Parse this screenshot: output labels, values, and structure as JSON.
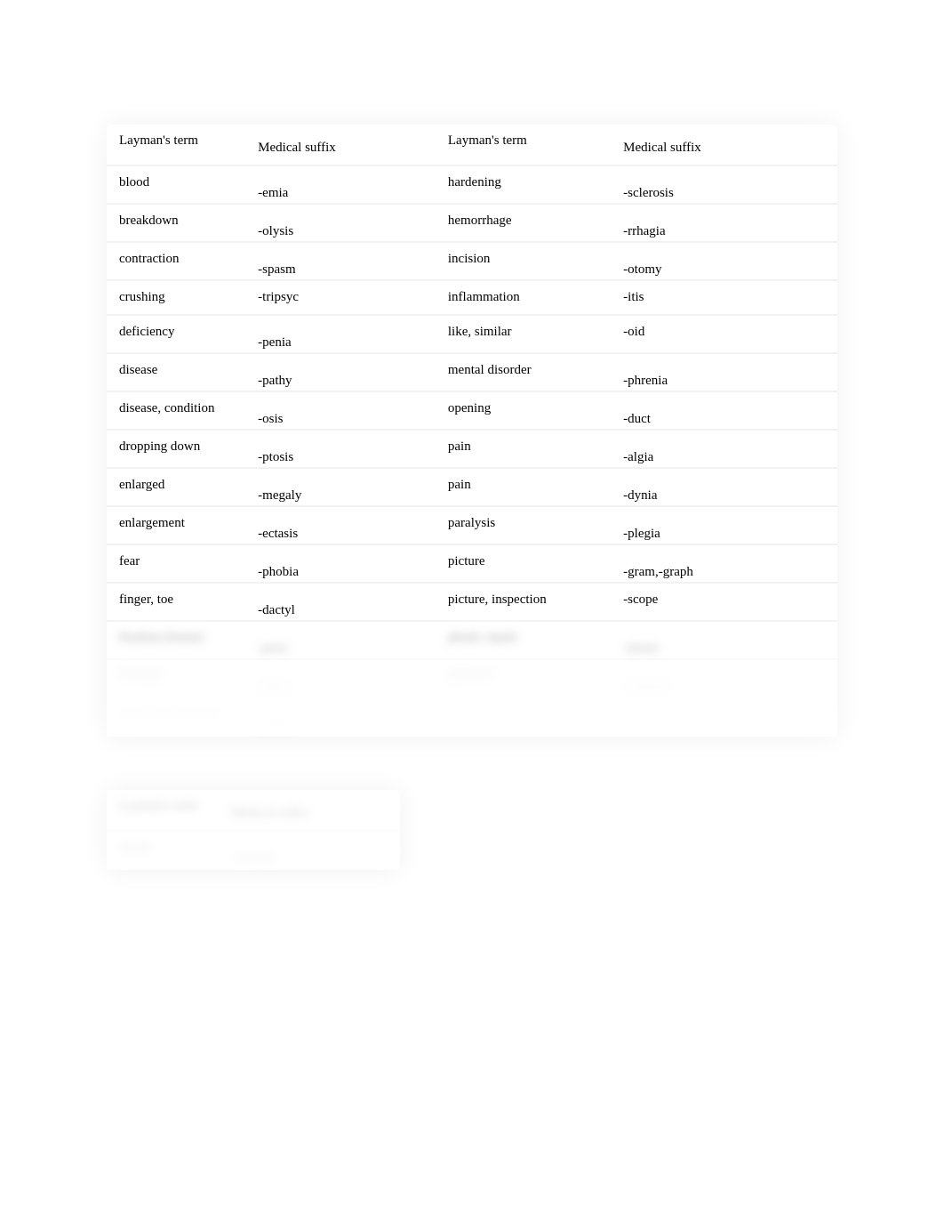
{
  "main_table": {
    "headers": [
      "Layman's term",
      "Medical suffix",
      "Layman's term",
      "Medical suffix"
    ],
    "rows": [
      {
        "a": "blood",
        "b": "-emia",
        "c": "hardening",
        "d": "-sclerosis"
      },
      {
        "a": "breakdown",
        "b": "-olysis",
        "c": "hemorrhage",
        "d": "-rrhagia"
      },
      {
        "a": "contraction",
        "b": "-spasm",
        "c": "incision",
        "d": "-otomy"
      },
      {
        "a": "crushing",
        "b": "-tripsyc",
        "c": "inflammation",
        "d": "-itis"
      },
      {
        "a": "deficiency",
        "b": "-penia",
        "c": "like, similar",
        "d": "-oid"
      },
      {
        "a": "disease",
        "b": "-pathy",
        "c": "mental disorder",
        "d": "-phrenia"
      },
      {
        "a": "disease, condition",
        "b": "-osis",
        "c": "opening",
        "d": "-duct"
      },
      {
        "a": "dropping down",
        "b": "-ptosis",
        "c": "pain",
        "d": "-algia"
      },
      {
        "a": "enlarged",
        "b": "-megaly",
        "c": "pain",
        "d": "-dynia"
      },
      {
        "a": "enlargement",
        "b": "-ectasis",
        "c": "paralysis",
        "d": "-plegia"
      },
      {
        "a": "fear",
        "b": "-phobia",
        "c": "picture",
        "d": "-gram,-graph"
      },
      {
        "a": "finger, toe",
        "b": "-dactyl",
        "c": "picture,   inspection",
        "d": "-scope"
      },
      {
        "a": "fixation (tissue)",
        "b": "-pexy",
        "c": "plastic repair",
        "d": "-plasty"
      },
      {
        "a": "flowing",
        "b": "-rrhea",
        "c": "puncture",
        "d": "-centesis"
      },
      {
        "a": "growth (abnormal)",
        "b": "-plasia",
        "c": "",
        "d": ""
      }
    ]
  },
  "small_table": {
    "headers": [
      "Layman's term",
      "Medical suffix"
    ],
    "rows": [
      {
        "a": "tumor",
        "b": "-rrhaphy"
      }
    ]
  }
}
